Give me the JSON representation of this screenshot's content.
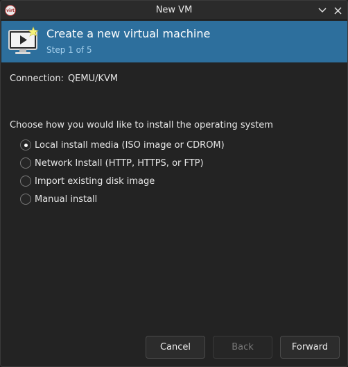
{
  "window": {
    "title": "New VM",
    "app_icon_text": "virt"
  },
  "banner": {
    "title": "Create a new virtual machine",
    "step": "Step 1 of 5",
    "icon": "monitor-play-icon"
  },
  "connection": {
    "label": "Connection:",
    "value": "QEMU/KVM"
  },
  "install": {
    "question": "Choose how you would like to install the operating system",
    "options": [
      {
        "label": "Local install media (ISO image or CDROM)",
        "checked": true
      },
      {
        "label": "Network Install (HTTP, HTTPS, or FTP)",
        "checked": false
      },
      {
        "label": "Import existing disk image",
        "checked": false
      },
      {
        "label": "Manual install",
        "checked": false
      }
    ]
  },
  "buttons": {
    "cancel": "Cancel",
    "back": "Back",
    "forward": "Forward"
  },
  "colors": {
    "banner": "#2d6f9d",
    "window_bg": "#232323",
    "step_text": "#a9d3ef"
  }
}
